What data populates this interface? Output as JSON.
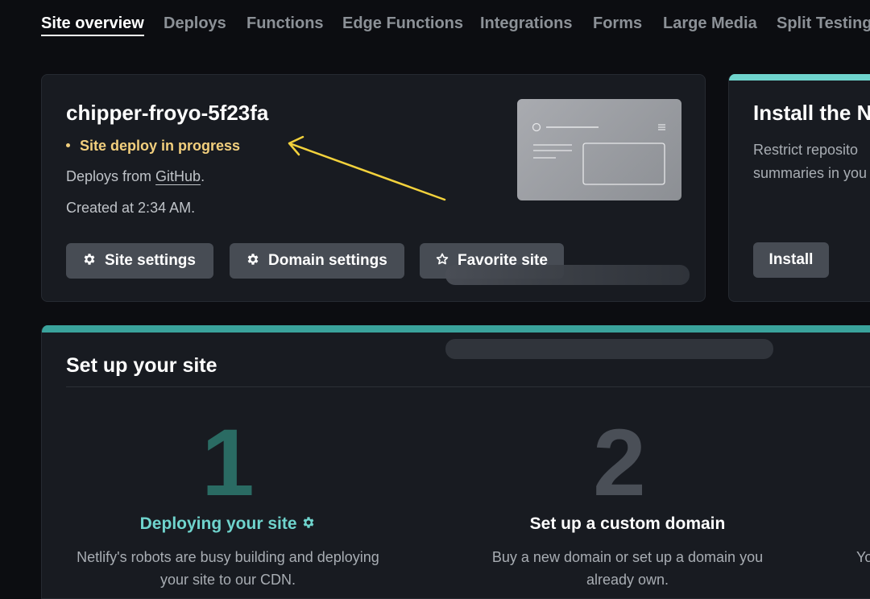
{
  "nav": {
    "items": [
      {
        "label": "Site overview",
        "active": true
      },
      {
        "label": "Deploys"
      },
      {
        "label": "Functions"
      },
      {
        "label": "Edge Functions"
      },
      {
        "label": "Integrations"
      },
      {
        "label": "Forms"
      },
      {
        "label": "Large Media"
      },
      {
        "label": "Split Testing"
      }
    ]
  },
  "site": {
    "name": "chipper-froyo-5f23fa",
    "status": "Site deploy in progress",
    "deploys_from_prefix": "Deploys from",
    "deploys_from_link": "GitHub",
    "deploys_from_suffix": ".",
    "created": "Created at 2:34 AM.",
    "buttons": {
      "site_settings": "Site settings",
      "domain_settings": "Domain settings",
      "favorite": "Favorite site"
    }
  },
  "install": {
    "title": "Install the Ne",
    "desc_line1": "Restrict reposito",
    "desc_line2": "summaries in you",
    "button": "Install"
  },
  "setup": {
    "title": "Set up your site",
    "steps": [
      {
        "number": "1",
        "title": "Deploying your site",
        "desc_line1": "Netlify's robots are busy building and deploying",
        "desc_line2": "your site to our CDN."
      },
      {
        "number": "2",
        "title": "Set up a custom domain",
        "desc_line1": "Buy a new domain or set up a domain you",
        "desc_line2": "already own."
      },
      {
        "desc_line1": "Yo"
      }
    ]
  },
  "colors": {
    "background": "#0c0d11",
    "card": "#181b21",
    "accent_teal": "#6fd4cd",
    "status_yellow": "#f2cf7d",
    "arrow_yellow": "#f3d23c",
    "button": "#474c54"
  },
  "icons": {
    "settings": "gear-icon",
    "favorite": "star-outline-icon",
    "status": "dot-icon",
    "deploying": "gear-icon"
  }
}
